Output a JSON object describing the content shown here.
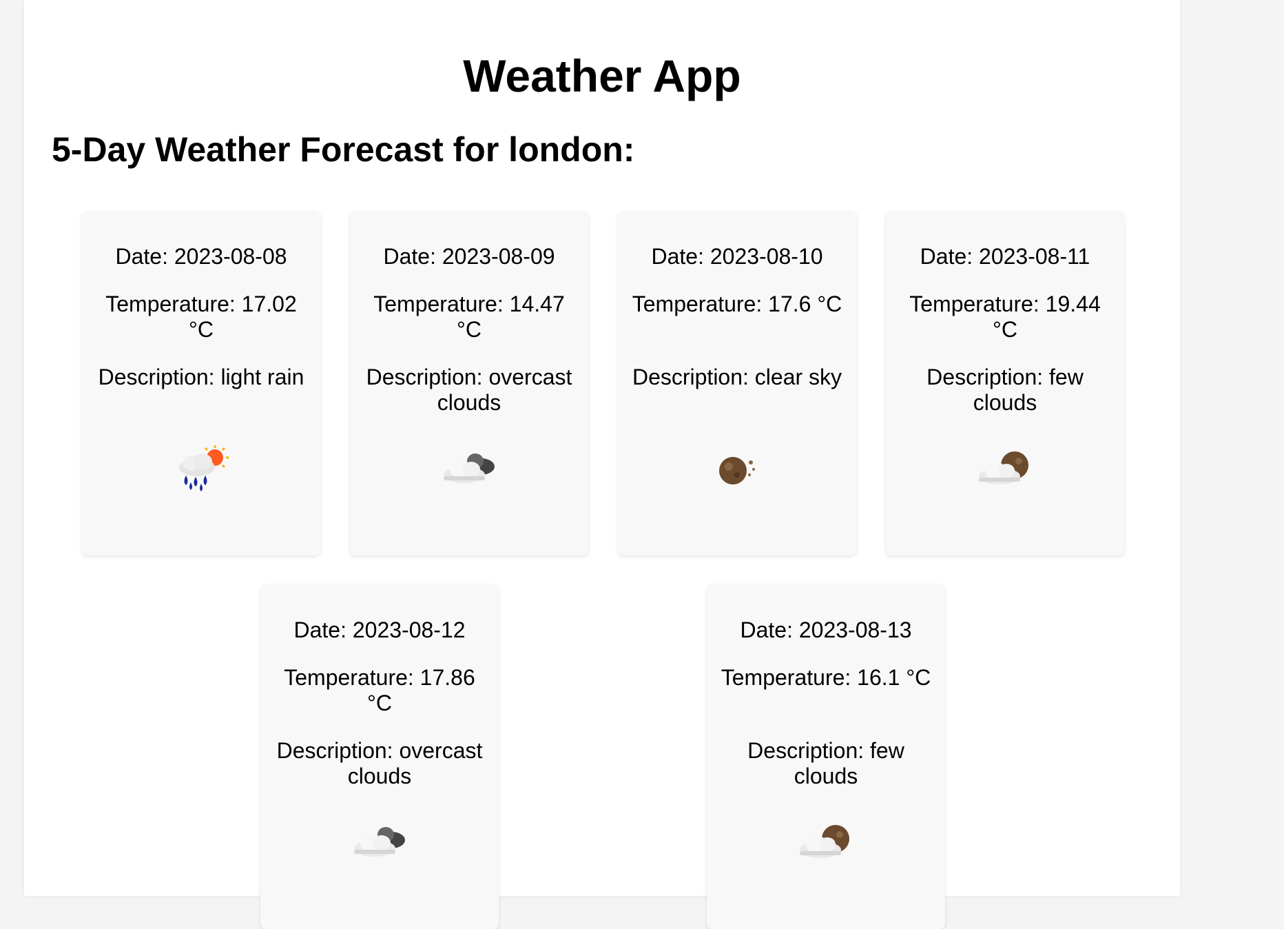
{
  "app": {
    "title": "Weather App"
  },
  "forecast": {
    "heading": "5-Day Weather Forecast for london:",
    "labels": {
      "date": "Date:",
      "temperature": "Temperature:",
      "description": "Description:",
      "unit": "°C"
    },
    "days": [
      {
        "date": "Date: 2023-08-08",
        "temperature": "Temperature: 17.02 °C",
        "description": "Description: light rain",
        "icon": "light-rain-icon"
      },
      {
        "date": "Date: 2023-08-09",
        "temperature": "Temperature: 14.47 °C",
        "description": "Description: overcast clouds",
        "icon": "overcast-clouds-icon"
      },
      {
        "date": "Date: 2023-08-10",
        "temperature": "Temperature: 17.6 °C",
        "description": "Description: clear sky",
        "icon": "clear-sky-night-icon"
      },
      {
        "date": "Date: 2023-08-11",
        "temperature": "Temperature: 19.44 °C",
        "description": "Description: few clouds",
        "icon": "few-clouds-night-icon"
      },
      {
        "date": "Date: 2023-08-12",
        "temperature": "Temperature: 17.86 °C",
        "description": "Description: overcast clouds",
        "icon": "overcast-clouds-icon"
      },
      {
        "date": "Date: 2023-08-13",
        "temperature": "Temperature: 16.1 °C",
        "description": "Description: few clouds",
        "icon": "few-clouds-night-icon"
      }
    ]
  },
  "colors": {
    "background": "#f4f4f4",
    "page": "#ffffff",
    "card": "#f8f8f8",
    "text": "#000000"
  }
}
